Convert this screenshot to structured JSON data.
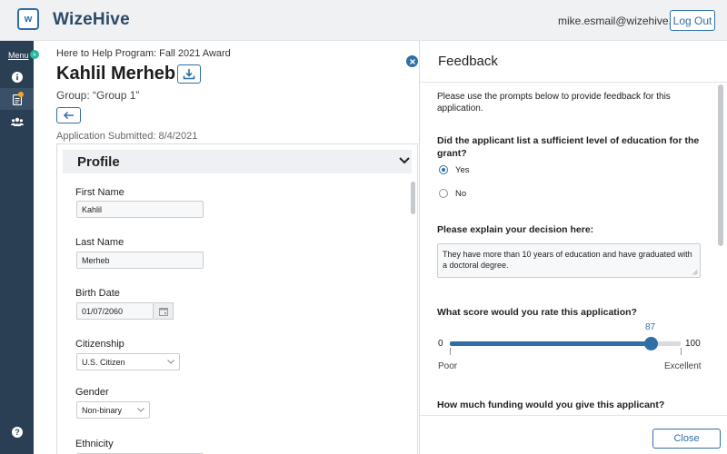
{
  "header": {
    "logo_letter": "w",
    "brand": "WizeHive",
    "user_email": "mike.esmail@wizehive.org",
    "logout_label": "Log Out"
  },
  "sidebar": {
    "menu_label": "Menu",
    "menu_toggle": "»",
    "items": [
      {
        "icon": "info-icon",
        "active": false
      },
      {
        "icon": "document-icon",
        "active": true,
        "badge": true
      },
      {
        "icon": "users-icon",
        "active": false
      }
    ],
    "help_icon": "help-icon"
  },
  "application": {
    "program": "Here to Help Program: Fall 2021 Award",
    "applicant_name": "Kahlil Merheb",
    "group": "Group: “Group 1”",
    "submitted": "Application Submitted: 8/4/2021"
  },
  "profile": {
    "title": "Profile",
    "fields": {
      "first_name": {
        "label": "First Name",
        "value": "Kahlil"
      },
      "last_name": {
        "label": "Last Name",
        "value": "Merheb"
      },
      "birth_date": {
        "label": "Birth Date",
        "value": "01/07/2060"
      },
      "citizenship": {
        "label": "Citizenship",
        "value": "U.S. Citizen"
      },
      "gender": {
        "label": "Gender",
        "value": "Non-binary"
      },
      "ethnicity": {
        "label": "Ethnicity"
      }
    }
  },
  "feedback": {
    "title": "Feedback",
    "intro": "Please use the prompts below to provide feedback for this application.",
    "q1": {
      "question": "Did the applicant list a sufficient level of education for the grant?",
      "options": [
        "Yes",
        "No"
      ],
      "selected": "Yes"
    },
    "q2": {
      "question": "Please explain your decision here:",
      "answer": "They have more than 10 years of education and have graduated with a doctoral degree."
    },
    "q3": {
      "question": "What score would you rate this application?",
      "min": "0",
      "max": "100",
      "value": "87",
      "value_num": 87,
      "low_label": "Poor",
      "high_label": "Excellent"
    },
    "q4": {
      "question": "How much funding would you give this applicant?"
    },
    "close_label": "Close"
  },
  "colors": {
    "accent": "#2f6fa6",
    "sidebar_bg": "#2b3f54",
    "badge": "#f5a623",
    "menu_dot": "#28b89b"
  }
}
